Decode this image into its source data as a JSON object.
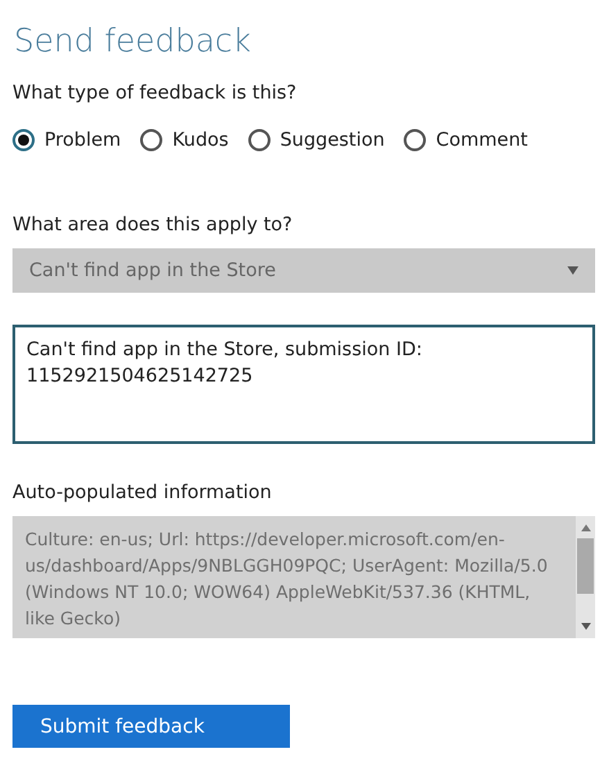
{
  "title": "Send feedback",
  "type_question": "What type of feedback is this?",
  "types": [
    {
      "label": "Problem",
      "selected": true
    },
    {
      "label": "Kudos",
      "selected": false
    },
    {
      "label": "Suggestion",
      "selected": false
    },
    {
      "label": "Comment",
      "selected": false
    }
  ],
  "area_question": "What area does this apply to?",
  "area_dropdown": {
    "value": "Can't find app in the Store"
  },
  "description": {
    "value": "Can't find app in the Store, submission ID:\n1152921504625142725"
  },
  "auto_label": "Auto-populated information",
  "auto_info": {
    "value": "Culture: en-us; Url: https://developer.microsoft.com/en-us/dashboard/Apps/9NBLGGH09PQC; UserAgent: Mozilla/5.0 (Windows NT 10.0; WOW64) AppleWebKit/537.36 (KHTML, like Gecko)"
  },
  "submit_button": "Submit feedback"
}
